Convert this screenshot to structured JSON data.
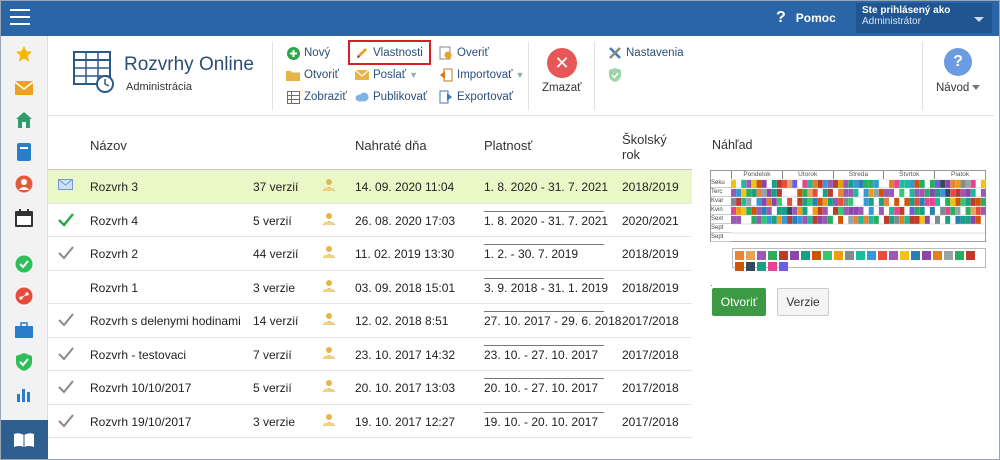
{
  "header": {
    "help_label": "Pomoc",
    "user_line1": "Ste prihlásený ako",
    "user_line2": "Administrátor"
  },
  "sidebar": {
    "icons": [
      "star-icon",
      "mail-icon",
      "home-icon",
      "book-icon",
      "user-icon",
      "calendar-icon",
      "check-circle-icon",
      "network-icon",
      "briefcase-icon",
      "shield-icon",
      "bar-chart-icon",
      "library-icon"
    ]
  },
  "app": {
    "title": "Rozvrhy Online",
    "subtitle": "Administrácia"
  },
  "toolbar": {
    "novy": "Nový",
    "otvorit": "Otvoriť",
    "zobrazit": "Zobraziť",
    "vlastnosti": "Vlastnosti",
    "poslat": "Poslať",
    "publikovat": "Publikovať",
    "overit": "Overiť",
    "importovat": "Importovať",
    "exportovat": "Exportovať",
    "zmazat": "Zmazať",
    "nastavenia": "Nastavenia",
    "navod": "Návod"
  },
  "table": {
    "headers": {
      "name": "Názov",
      "uploaded": "Nahraté dňa",
      "validity": "Platnosť",
      "school_year_1": "Školský",
      "school_year_2": "rok"
    },
    "rows": [
      {
        "status": "mail",
        "name": "Rozvrh 3",
        "versions": "37 verzií",
        "uploaded": "14. 09. 2020 11:04",
        "validity": "1. 8. 2020 - 31. 7. 2021",
        "year": "2018/2019"
      },
      {
        "status": "check-green",
        "name": "Rozvrh 4",
        "versions": "5 verzií",
        "uploaded": "26. 08. 2020 17:03",
        "validity": "1. 8. 2020 - 31. 7. 2021",
        "year": "2020/2021"
      },
      {
        "status": "check-gray",
        "name": "Rozvrh 2",
        "versions": "44 verzií",
        "uploaded": "11. 02. 2019 13:30",
        "validity": "1. 2. - 30. 7. 2019",
        "year": "2018/2019"
      },
      {
        "status": "none",
        "name": "Rozvrh 1",
        "versions": "3 verzie",
        "uploaded": "03. 09. 2018 15:01",
        "validity": "3. 9. 2018 - 31. 1. 2019",
        "year": "2018/2019"
      },
      {
        "status": "check-gray",
        "name": "Rozvrh s delenymi hodinami",
        "versions": "14 verzií",
        "uploaded": "12. 02. 2018 8:51",
        "validity": "27. 10. 2017 - 29. 6. 2018",
        "year": "2017/2018"
      },
      {
        "status": "check-gray",
        "name": "Rozvrh - testovaci",
        "versions": "7 verzií",
        "uploaded": "23. 10. 2017 14:32",
        "validity": "23. 10. - 27. 10. 2017",
        "year": "2017/2018"
      },
      {
        "status": "check-gray",
        "name": "Rozvrh 10/10/2017",
        "versions": "5 verzií",
        "uploaded": "20. 10. 2017 13:03",
        "validity": "20. 10. - 27. 10. 2017",
        "year": "2017/2018"
      },
      {
        "status": "check-gray",
        "name": "Rozvrh 19/10/2017",
        "versions": "3 verzie",
        "uploaded": "19. 10. 2017 12:27",
        "validity": "19. 10. - 20. 10. 2017",
        "year": "2017/2018"
      }
    ]
  },
  "preview": {
    "title": "Náhľad",
    "days": [
      "Pondelok",
      "Utorok",
      "Streda",
      "Štvrtok",
      "Piatok"
    ],
    "classes": [
      "Seku",
      "Terc",
      "Kvar",
      "Kvin",
      "Sext",
      "Sept",
      "Sept"
    ],
    "dot": ".",
    "open_label": "Otvoriť",
    "versions_label": "Verzie",
    "palette": [
      "#e8833a",
      "#e8a35a",
      "#9b59b6",
      "#27ae60",
      "#c0392b",
      "#8e44ad",
      "#16a085",
      "#d35400",
      "#2ecc71",
      "#f39c12",
      "#7f8c8d",
      "#1abc9c",
      "#3498db",
      "#e74c3c",
      "#9b59b6",
      "#f1c40f",
      "#2980b9",
      "#8e44ad",
      "#e67e22",
      "#95a5a6",
      "#27ae60",
      "#c0392b",
      "#d35400",
      "#34495e",
      "#16a085",
      "#e84393",
      "#6c5ce7"
    ]
  },
  "colors": {
    "accent": "#2a65a8",
    "selected_row": "#e9f8c6",
    "open_button": "#3d9a44",
    "highlight_border": "#d9202a"
  }
}
